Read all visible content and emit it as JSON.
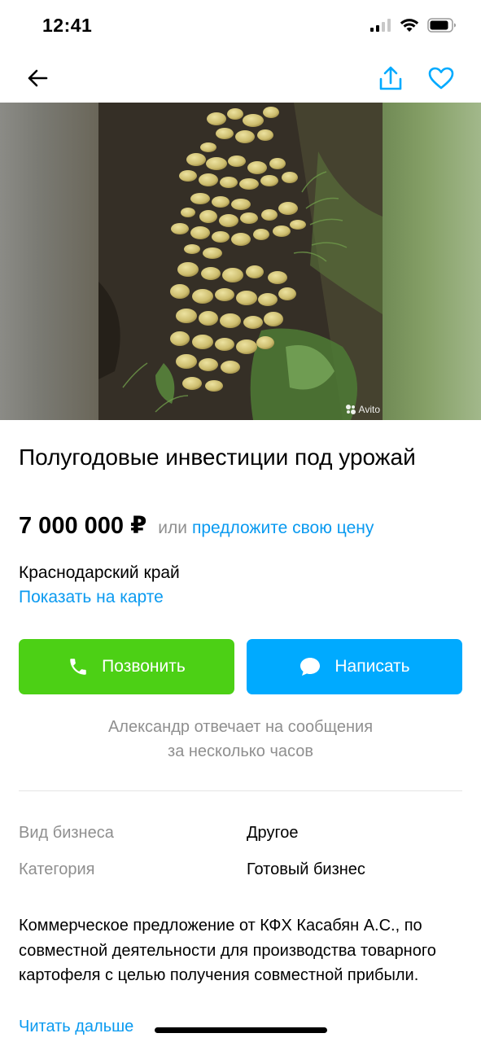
{
  "status_bar": {
    "time": "12:41"
  },
  "nav": {
    "back_icon": "arrow-left-icon",
    "share_icon": "share-icon",
    "favorite_icon": "heart-icon"
  },
  "gallery": {
    "image_alt": "potato harvest photo",
    "watermark": "Avito"
  },
  "listing": {
    "title": "Полугодовые инвестиции под урожай",
    "price": "7 000 000 ₽",
    "price_or": "или",
    "price_offer_link": "предложите свою цену",
    "location": "Краснодарский край",
    "map_link": "Показать на карте"
  },
  "actions": {
    "call_label": "Позвонить",
    "write_label": "Написать",
    "reply_note_line1": "Александр отвечает на сообщения",
    "reply_note_line2": "за несколько часов"
  },
  "params": [
    {
      "label": "Вид бизнеса",
      "value": "Другое"
    },
    {
      "label": "Категория",
      "value": "Готовый бизнес"
    }
  ],
  "description": {
    "text": "Коммерческое предложение от КФХ Касабян А.С., по совместной деятельности для производства товарного картофеля с целью получения совместной прибыли.",
    "read_more": "Читать дальше"
  },
  "colors": {
    "accent_blue": "#00aaff",
    "link_blue": "#0a9af0",
    "call_green": "#4cd015",
    "muted_text": "#8f8f8f"
  }
}
